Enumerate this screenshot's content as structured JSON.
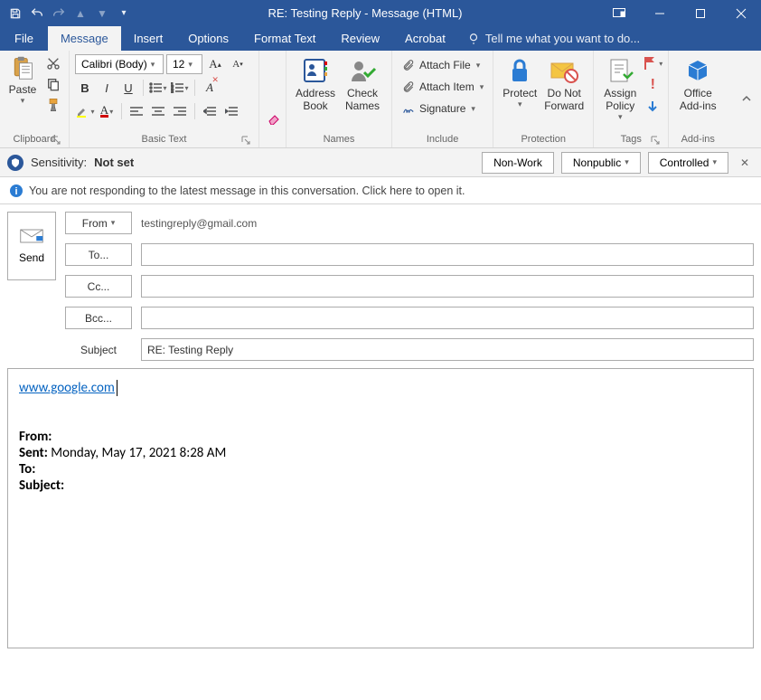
{
  "title": "RE: Testing Reply - Message (HTML)",
  "tabs": {
    "file": "File",
    "message": "Message",
    "insert": "Insert",
    "options": "Options",
    "format_text": "Format Text",
    "review": "Review",
    "acrobat": "Acrobat",
    "tellme": "Tell me what you want to do..."
  },
  "ribbon": {
    "clipboard": {
      "paste": "Paste",
      "label": "Clipboard"
    },
    "basic_text": {
      "font_name": "Calibri (Body)",
      "font_size": "12",
      "label": "Basic Text"
    },
    "names": {
      "address_book": "Address\nBook",
      "check_names": "Check\nNames",
      "label": "Names"
    },
    "include": {
      "attach_file": "Attach File",
      "attach_item": "Attach Item",
      "signature": "Signature",
      "label": "Include"
    },
    "protection": {
      "protect": "Protect",
      "do_not_forward": "Do Not\nForward",
      "label": "Protection"
    },
    "tags": {
      "assign_policy": "Assign\nPolicy",
      "label": "Tags"
    },
    "addins": {
      "office_addins": "Office\nAdd-ins",
      "label": "Add-ins"
    }
  },
  "sensitivity": {
    "label": "Sensitivity:",
    "value": "Not set",
    "nonwork": "Non-Work",
    "nonpublic": "Nonpublic",
    "controlled": "Controlled"
  },
  "infobar": "You are not responding to the latest message in this conversation. Click here to open it.",
  "compose": {
    "send": "Send",
    "from_btn": "From",
    "from_value": "testingreply@gmail.com",
    "to_btn": "To...",
    "cc_btn": "Cc...",
    "bcc_btn": "Bcc...",
    "subject_label": "Subject",
    "subject_value": "RE: Testing Reply"
  },
  "body": {
    "link_text": "www.google.com",
    "quoted_from_label": "From:",
    "quoted_sent_label": "Sent:",
    "quoted_sent_value": " Monday, May 17, 2021 8:28 AM",
    "quoted_to_label": "To:",
    "quoted_subject_label": "Subject:"
  }
}
